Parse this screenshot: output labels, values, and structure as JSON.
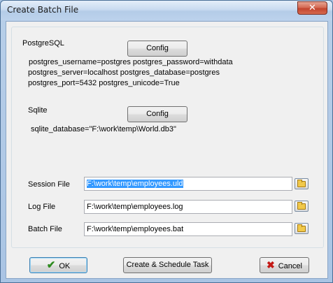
{
  "window": {
    "title": "Create Batch File",
    "close_glyph": "✕"
  },
  "postgres": {
    "heading": "PostgreSQL",
    "config_label": "Config",
    "lines": [
      "postgres_username=postgres postgres_password=withdata",
      "postgres_server=localhost postgres_database=postgres",
      "postgres_port=5432 postgres_unicode=True"
    ]
  },
  "sqlite": {
    "heading": "Sqlite",
    "config_label": "Config",
    "lines": [
      "sqlite_database=\"F:\\work\\temp\\World.db3\""
    ]
  },
  "files": {
    "session_label": "Session File",
    "session_value": "F:\\work\\temp\\employees.uld",
    "log_label": "Log File",
    "log_value": "F:\\work\\temp\\employees.log",
    "batch_label": "Batch File",
    "batch_value": "F:\\work\\temp\\employees.bat"
  },
  "buttons": {
    "ok_label": "OK",
    "ok_glyph": "✔",
    "schedule_label": "Create & Schedule Task",
    "cancel_label": "Cancel",
    "cancel_glyph": "✖"
  },
  "icons": {
    "browse": "folder-icon",
    "ok": "checkmark-icon",
    "cancel": "cross-icon",
    "close": "close-icon"
  },
  "colors": {
    "selection": "#3399ff",
    "ok_icon": "#2e8b1f",
    "cancel_icon": "#c41a16",
    "close_button": "#c2452e"
  }
}
